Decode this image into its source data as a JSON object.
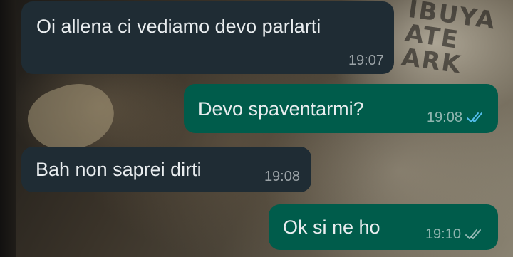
{
  "chat": {
    "messages": [
      {
        "direction": "incoming",
        "text": "Oi allena ci vediamo devo parlarti",
        "time": "19:07"
      },
      {
        "direction": "outgoing",
        "text": "Devo spaventarmi?",
        "time": "19:08",
        "status_icon": "double-check-read-icon",
        "status_color": "#53bdeb"
      },
      {
        "direction": "incoming",
        "text": "Bah non saprei dirti",
        "time": "19:08"
      },
      {
        "direction": "outgoing",
        "text": "Ok si ne ho",
        "time": "19:10",
        "status_icon": "double-check-delivered-icon",
        "status_color": "#aebac1"
      }
    ]
  },
  "wallpaper": {
    "shirt_lines": [
      "IBUYA",
      "ATE",
      "ARK"
    ]
  },
  "colors": {
    "incoming_bubble": "#1f2c34",
    "outgoing_bubble": "#005c4b",
    "message_text": "#e9edef",
    "read_tick": "#53bdeb"
  }
}
